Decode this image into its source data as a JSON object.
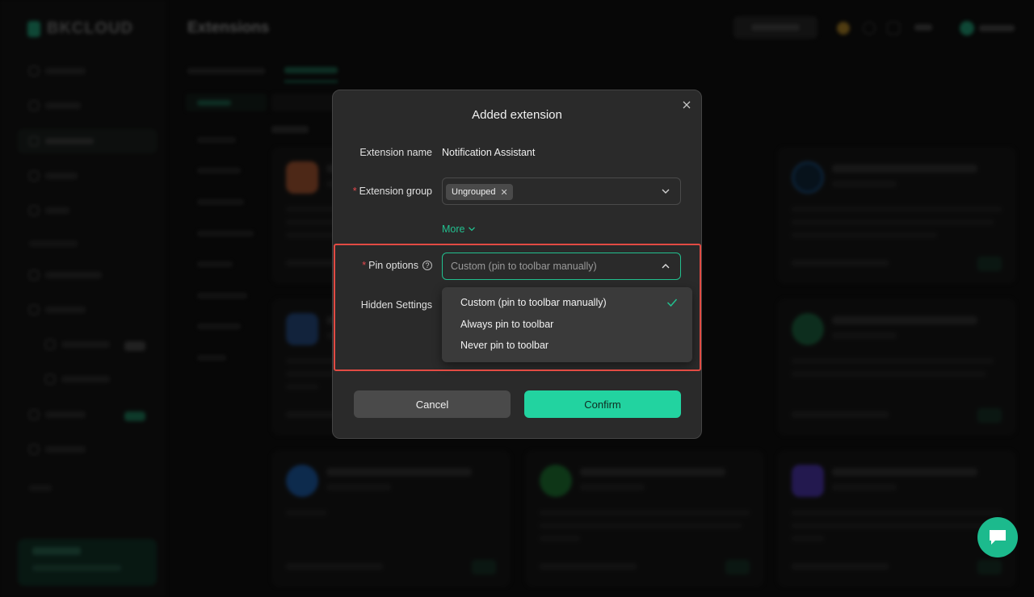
{
  "app": {
    "page_title": "Extensions",
    "logo_text": "BKCLOUD"
  },
  "modal": {
    "title": "Added extension",
    "extension_name_label": "Extension name",
    "extension_name_value": "Notification Assistant",
    "extension_group_label": "Extension group",
    "extension_group_tag": "Ungrouped",
    "more_label": "More",
    "pin_options_label": "Pin options",
    "pin_options_selected": "Custom (pin to toolbar manually)",
    "hidden_settings_label": "Hidden Settings",
    "pin_options_list": [
      {
        "label": "Custom (pin to toolbar manually)",
        "selected": true
      },
      {
        "label": "Always pin to toolbar",
        "selected": false
      },
      {
        "label": "Never pin to toolbar",
        "selected": false
      }
    ],
    "cancel_label": "Cancel",
    "confirm_label": "Confirm"
  },
  "colors": {
    "accent": "#22c08f",
    "confirm_bg": "#22d3a0",
    "highlight": "#e24b43",
    "required": "#e5484d"
  },
  "icons": [
    "close-icon",
    "chevron-down-icon",
    "chevron-up-icon",
    "help-icon",
    "check-icon",
    "tag-remove-icon",
    "chat-icon"
  ]
}
